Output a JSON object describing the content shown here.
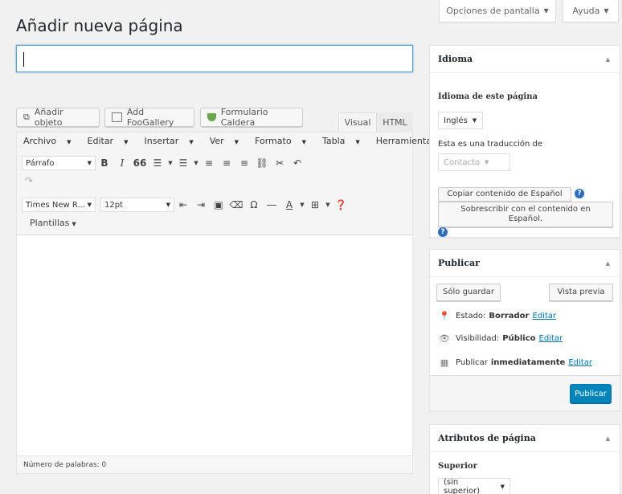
{
  "screen_options": {
    "label": "Opciones de pantalla"
  },
  "help_tab": {
    "label": "Ayuda"
  },
  "page_title": "Añadir nueva página",
  "title_field": {
    "value": "",
    "placeholder": ""
  },
  "media_buttons": [
    {
      "label": "Añadir objeto",
      "icon": "add-media-icon"
    },
    {
      "label": "Add FooGallery",
      "icon": "gallery-icon"
    },
    {
      "label": "Formulario Caldera",
      "icon": "caldera-icon"
    }
  ],
  "editor_tabs": {
    "visual": "Visual",
    "html": "HTML"
  },
  "menubar": [
    "Archivo",
    "Editar",
    "Insertar",
    "Ver",
    "Formato",
    "Tabla",
    "Herramientas"
  ],
  "toolbar": {
    "format_select": "Párrafo",
    "bold": "B",
    "italic": "I",
    "quote": "66",
    "font_family": "Times New R...",
    "font_size": "12pt",
    "omega": "Ω",
    "text_color": "A",
    "templates": "Plantillas"
  },
  "status": {
    "word_count_label": "Número de palabras: 0"
  },
  "language_box": {
    "title": "Idioma",
    "language_label": "Idioma de este página",
    "language_value": "Inglés",
    "translation_label": "Esta es una traducción de",
    "translation_value": "Contacto",
    "copy_button": "Copiar contenido de Español",
    "overwrite_button": "Sobrescribir con el contenido en Español."
  },
  "publish_box": {
    "title": "Publicar",
    "save_draft": "Sólo guardar",
    "preview": "Vista previa",
    "status_label": "Estado:",
    "status_value": "Borrador",
    "visibility_label": "Visibilidad:",
    "visibility_value": "Público",
    "publish_label": "Publicar",
    "publish_value": "inmediatamente",
    "edit_link": "Editar",
    "publish_button": "Publicar",
    "accent": "#0085ba"
  },
  "attributes_box": {
    "title": "Atributos de página",
    "parent_label": "Superior",
    "parent_value": "(sin superior)"
  }
}
